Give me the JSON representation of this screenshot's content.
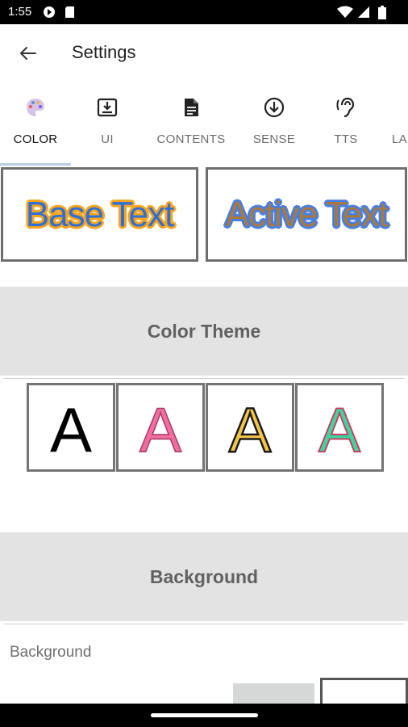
{
  "status_bar": {
    "time": "1:55",
    "icons": [
      "location-notification-icon",
      "sim-card-icon",
      "wifi-icon",
      "cell-signal-icon",
      "battery-icon"
    ]
  },
  "app_bar": {
    "title": "Settings",
    "back_icon": "arrow-back-icon"
  },
  "tabs": [
    {
      "label": "COLOR",
      "icon": "palette-icon",
      "active": true
    },
    {
      "label": "UI",
      "icon": "download-box-icon",
      "active": false
    },
    {
      "label": "CONTENTS",
      "icon": "document-icon",
      "active": false
    },
    {
      "label": "SENSE",
      "icon": "arrow-down-circle-icon",
      "active": false
    },
    {
      "label": "TTS",
      "icon": "hearing-icon",
      "active": false
    },
    {
      "label": "LA",
      "icon": "",
      "active": false
    }
  ],
  "preview": {
    "base_text": "Base Text",
    "active_text": "Active Text"
  },
  "sections": {
    "color_theme": "Color Theme",
    "background": "Background"
  },
  "color_themes": [
    {
      "glyph": "A",
      "fill": "#000000",
      "stroke": "#000000"
    },
    {
      "glyph": "A",
      "fill": "#ef6fa0",
      "stroke": "#a83a66"
    },
    {
      "glyph": "A",
      "fill": "#f3c54a",
      "stroke": "#1a1a1a"
    },
    {
      "glyph": "A",
      "fill": "#3fd3a0",
      "stroke": "#d1335a"
    }
  ],
  "background": {
    "label": "Background",
    "swatches": [
      "#d6d7d7",
      "#ffffff"
    ]
  },
  "colors": {
    "tab_indicator": "#b9cde6",
    "section_bg": "#e3e3e3",
    "section_text": "#616161"
  }
}
